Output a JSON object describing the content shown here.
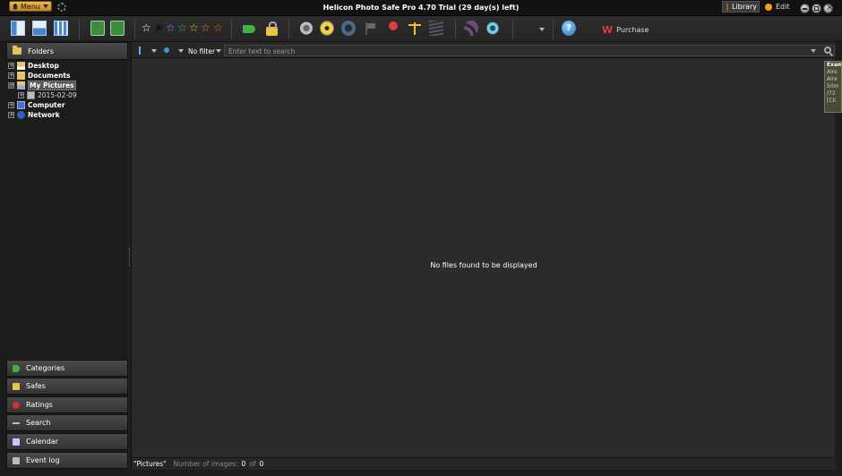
{
  "titlebar": {
    "menu_label": "Menu",
    "title": "Helicon Photo Safe Pro 4.70 Trial (29 day(s) left)",
    "mode_library": "Library",
    "mode_edit": "Edit"
  },
  "toolbar": {
    "stars": [
      "☆",
      "★",
      "☆",
      "☆",
      "☆",
      "☆"
    ],
    "star_colors": [
      "#ffffff",
      "#111111",
      "#5ab0ff",
      "#3fc03f",
      "#f0c030",
      "#ff7a20"
    ],
    "purchase_label": "Purchase",
    "help_glyph": "?"
  },
  "left_panel": {
    "header": "Folders",
    "tree": [
      {
        "label": "Desktop",
        "expander": "+"
      },
      {
        "label": "Documents",
        "expander": "+"
      },
      {
        "label": "My Pictures",
        "expander": "−"
      },
      {
        "label": "2015-02-09",
        "expander": "+"
      },
      {
        "label": "Computer",
        "expander": "+"
      },
      {
        "label": "Network",
        "expander": "+"
      }
    ],
    "nav": [
      {
        "label": "Categories",
        "icon": "tag-icon"
      },
      {
        "label": "Safes",
        "icon": "lock-icon"
      },
      {
        "label": "Ratings",
        "icon": "rating-icon"
      },
      {
        "label": "Search",
        "icon": "search-icon"
      },
      {
        "label": "Calendar",
        "icon": "calendar-icon"
      },
      {
        "label": "Event log",
        "icon": "log-icon"
      }
    ]
  },
  "filterbar": {
    "filter_label": "No filter",
    "search_placeholder": "Enter text to search",
    "search_value": ""
  },
  "main": {
    "empty_message": "No files found to be displayed"
  },
  "statusbar": {
    "path": "\"Pictures\"",
    "count_label": "Number of images:",
    "count": "0",
    "of": "of",
    "total": "0"
  },
  "side_tip": {
    "lines": [
      "Exam",
      "Alre",
      "Alre",
      "50m",
      "/72",
      "[Cli"
    ]
  }
}
